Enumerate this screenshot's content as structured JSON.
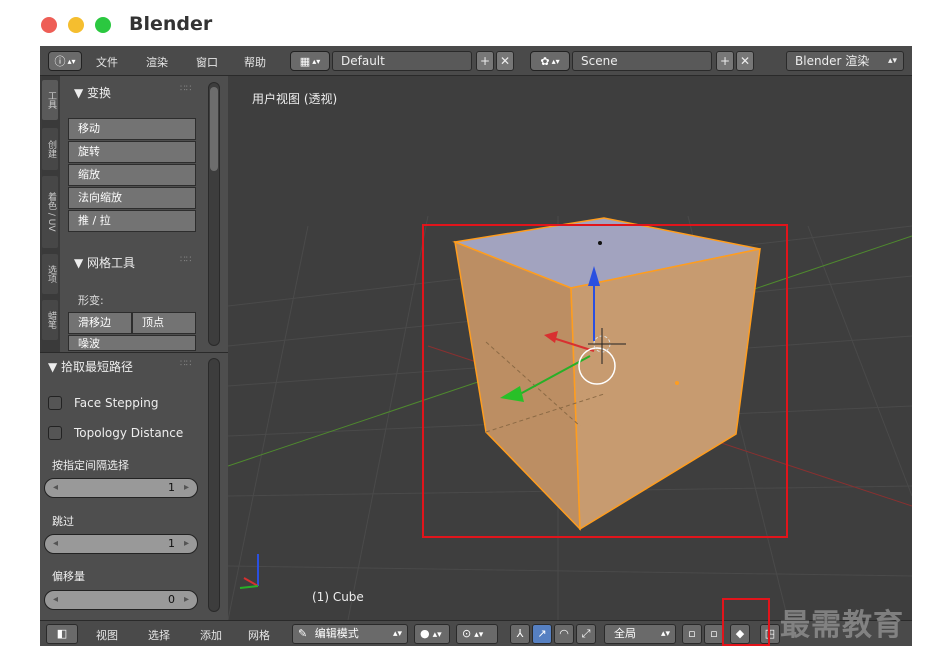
{
  "window": {
    "title": "Blender"
  },
  "top_header": {
    "info_icon": "info-icon",
    "menus": [
      "文件",
      "渲染",
      "窗口",
      "帮助"
    ],
    "screen_layout": "Default",
    "scene": "Scene",
    "render_engine": "Blender 渲染"
  },
  "tool_tabs": [
    "工具",
    "创建",
    "着色 / UV",
    "选项",
    "蜡笔"
  ],
  "transform_panel": {
    "title": "▼ 变换",
    "buttons": [
      "移动",
      "旋转",
      "缩放",
      "法向缩放",
      "推 / 拉"
    ]
  },
  "mesh_tools_panel": {
    "title": "▼ 网格工具",
    "deform_label": "形变:",
    "buttons": [
      "滑移边",
      "顶点",
      "噪波"
    ]
  },
  "operator_panel": {
    "title": "▼ 拾取最短路径",
    "options": [
      {
        "label": "Face Stepping",
        "checked": false
      },
      {
        "label": "Topology Distance",
        "checked": false
      }
    ],
    "fields": [
      {
        "label": "按指定间隔选择",
        "value": "1"
      },
      {
        "label": "跳过",
        "value": "1"
      },
      {
        "label": "偏移量",
        "value": "0"
      }
    ]
  },
  "viewport": {
    "view_label": "用户视图 (透视)",
    "object_label": "(1) Cube"
  },
  "bottom_header": {
    "menus": [
      "视图",
      "选择",
      "添加",
      "网格"
    ],
    "mode": "编辑模式",
    "pivot": "全局"
  },
  "watermark": "最需教育",
  "colors": {
    "highlight": "#e1141b",
    "cube_face": "#c69a6d",
    "cube_edge": "#ff9d1e"
  }
}
